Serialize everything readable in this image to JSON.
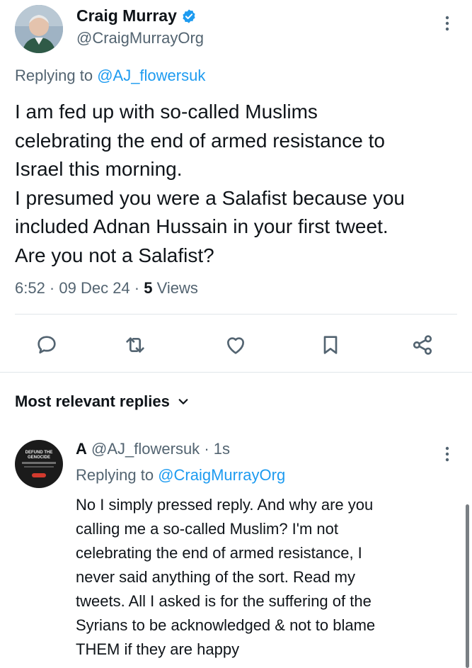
{
  "tweet": {
    "author_name": "Craig Murray",
    "author_handle": "@CraigMurrayOrg",
    "replying_prefix": "Replying to ",
    "replying_to": "@AJ_flowersuk",
    "text_lines": [
      "I am fed up with so-called Muslims",
      "celebrating the end of armed resistance to",
      "Israel this morning.",
      "I presumed you were a Salafist because you",
      "included Adnan Hussain in your first tweet.",
      "Are you not a Salafist?"
    ],
    "time": "6:52 · 09 Dec 24 · ",
    "views_count": "5",
    "views_label": " Views",
    "verified_color": "#1d9bf0",
    "verified_icon": "verified-badge-icon"
  },
  "actions": [
    {
      "name": "reply-button",
      "icon": "speech-bubble-icon"
    },
    {
      "name": "retweet-button",
      "icon": "retweet-icon"
    },
    {
      "name": "like-button",
      "icon": "heart-icon"
    },
    {
      "name": "bookmark-button",
      "icon": "bookmark-icon"
    },
    {
      "name": "share-button",
      "icon": "share-icon"
    }
  ],
  "replies_section": {
    "sort_label": "Most relevant replies"
  },
  "reply": {
    "avatar_text": "DEFUND THE GENOCIDE",
    "author_name": "A",
    "author_handle": "@AJ_flowersuk",
    "time": "· 1s",
    "replying_prefix": "Replying to ",
    "replying_to": "@CraigMurrayOrg",
    "text_lines": [
      "No I simply pressed reply. And why are you",
      "calling me a so-called Muslim? I'm not",
      "celebrating the end of armed resistance, I",
      "never said anything of the sort. Read my",
      "tweets. All I asked is for the suffering of the",
      "Syrians to be acknowledged & not to blame",
      "THEM if they are happy"
    ]
  },
  "colors": {
    "text_primary": "#0f1419",
    "text_secondary": "#536471",
    "accent": "#1d9bf0"
  }
}
